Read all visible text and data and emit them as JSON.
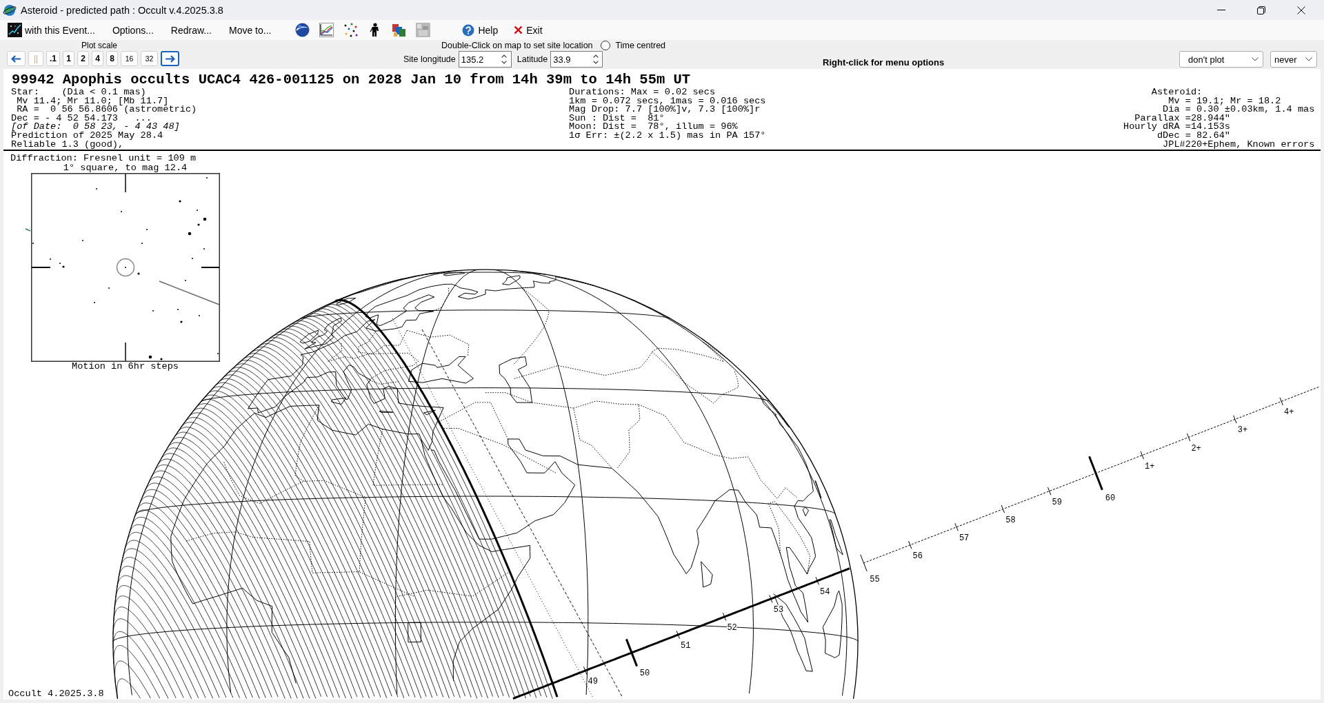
{
  "window": {
    "title": "Asteroid - predicted path : Occult v.4.2025.3.8"
  },
  "menu": [
    {
      "label": "with this Event...",
      "kind": "event"
    },
    {
      "label": "Options...",
      "kind": "plain"
    },
    {
      "label": "Redraw...",
      "kind": "plain"
    },
    {
      "label": "Move to...",
      "kind": "plain"
    }
  ],
  "commands": [
    {
      "label": "Help",
      "kind": "help"
    },
    {
      "label": "Exit",
      "kind": "exit"
    }
  ],
  "plot_scale": {
    "label": "Plot scale",
    "buttons": [
      {
        "kind": "arrow-left",
        "focused": false
      },
      {
        "kind": "pause",
        "label": "||",
        "focused": false
      },
      {
        "kind": "scale",
        "label": ".1",
        "focused": false
      },
      {
        "kind": "scale",
        "label": "1",
        "focused": false
      },
      {
        "kind": "scale",
        "label": "2",
        "focused": false
      },
      {
        "kind": "scale",
        "label": "4",
        "focused": false
      },
      {
        "kind": "scale",
        "label": "8",
        "focused": false
      },
      {
        "kind": "scale-small",
        "label": "16",
        "focused": false
      },
      {
        "kind": "scale-small",
        "label": "32",
        "focused": false
      },
      {
        "kind": "arrow-right",
        "focused": true
      }
    ]
  },
  "site": {
    "hint": "Double-Click on map to set site location",
    "time_centred": {
      "label": "Time centred",
      "checked": false
    },
    "longitude": {
      "label": "Site longitude",
      "value": "135.2"
    },
    "latitude": {
      "label": "Latitude",
      "value": "33.9"
    }
  },
  "menu_hint": "Right-click for menu options",
  "dropdowns": [
    {
      "value": "don't plot"
    },
    {
      "value": "never"
    }
  ],
  "header": {
    "title": "99942 Apophis occults UCAC4 426-001125 on 2028 Jan 10 from 14h 39m to 14h 55m UT",
    "star_lines": [
      {
        "text": "Star:    (Dia < 0.1 mas)",
        "kind": "plain"
      },
      {
        "text": "Mv 11.4; Mr 11.0; [Mb 11.7]",
        "kind": "plain"
      },
      {
        "text": "RA =  0 56 56.8606 (astrometric)",
        "kind": "plain"
      },
      {
        "text": "Dec = - 4 52 54.173   ...",
        "kind": "plain"
      },
      {
        "text": "[of Date:  0 58 23, - 4 43 48]",
        "kind": "italic"
      },
      {
        "text": "Prediction of 2025 May 28.4",
        "kind": "plain"
      },
      {
        "text": "Reliable 1.3 (good),",
        "kind": "plain"
      }
    ],
    "duration_lines": [
      "Durations: Max = 0.02 secs",
      "1km = 0.072 secs, 1mas = 0.016 secs",
      "Mag Drop: 7.7 [100%]v, 7.3 [100%]r",
      "Sun : Dist =  81°",
      "Moon: Dist =  78°, illum = 96%",
      "1σ Err: ±(2.2 x 1.5) mas in PA 157°"
    ],
    "asteroid_lines": [
      "Asteroid:",
      "Mv = 19.1; Mr = 18.2",
      "Dia = 0.30 ±0.03km, 1.4 mas",
      "Parallax =28.944\"",
      "Hourly dRA =14.153s",
      "dDec = 82.64\"",
      "JPL#220+Ephem, Known errors"
    ]
  },
  "inset": {
    "heading": "Diffraction: Fresnel unit = 109 m",
    "title": "1° square, to mag 12.4",
    "caption": "Motion in 6hr steps"
  },
  "map": {
    "track_labels": [
      "49",
      "50",
      "51",
      "52",
      "53",
      "54"
    ],
    "extension_labels": [
      "55",
      "56",
      "57",
      "58",
      "59",
      "60",
      "1+",
      "2+",
      "3+",
      "4+"
    ]
  },
  "status": "Occult 4.2025.3.8"
}
